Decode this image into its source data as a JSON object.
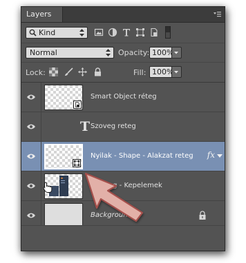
{
  "panel": {
    "tab_label": "Layers",
    "menu_icon": "panel-menu-icon"
  },
  "filter": {
    "kind_label": "Kind",
    "icons": [
      "image-filter-icon",
      "adjustment-filter-icon",
      "type-filter-icon",
      "shape-filter-icon",
      "smart-object-filter-icon",
      "filter-toggle-icon"
    ]
  },
  "blend": {
    "mode": "Normal",
    "opacity_label": "Opacity:",
    "opacity_value": "100%"
  },
  "lock": {
    "label": "Lock:",
    "fill_label": "Fill:",
    "fill_value": "100%"
  },
  "layers": [
    {
      "name": "Smart Object réteg",
      "type": "smart-object",
      "visible": true,
      "selected": false
    },
    {
      "name": "Szoveg reteg",
      "type": "text",
      "visible": true,
      "selected": false
    },
    {
      "name": "Nyilak - Shape - Alakzat reteg",
      "type": "shape",
      "visible": true,
      "selected": true,
      "fx": "fx"
    },
    {
      "name": "Kepelemek",
      "name_prefix": "reteg -",
      "type": "image",
      "visible": true,
      "selected": false
    },
    {
      "name": "Background",
      "type": "background",
      "visible": true,
      "selected": false,
      "locked": true
    }
  ],
  "colors": {
    "panel_bg": "#535353",
    "selected_row": "#7990b3",
    "arrow_fill": "#e2b0a8",
    "arrow_stroke": "#a4504c"
  }
}
